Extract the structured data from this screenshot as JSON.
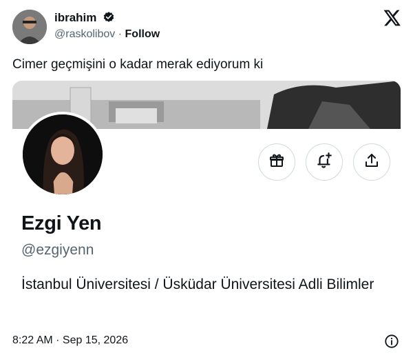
{
  "author": {
    "name": "ibrahim",
    "handle": "@raskolibov",
    "separator": "·",
    "follow_label": "Follow",
    "verified_icon": "verified-badge-icon",
    "verified_color": "#0f1419"
  },
  "platform_icon": "x-logo-icon",
  "tweet": {
    "text": "Cimer geçmişini o kadar merak ediyorum ki",
    "timestamp": "8:22 AM · Sep 15, 2026"
  },
  "profile_card": {
    "display_name": "Ezgi Yen",
    "handle": "@ezgiyenn",
    "bio": "İstanbul Üniversitesi / Üsküdar Üniversitesi Adli Bilimler",
    "actions": [
      {
        "icon": "gift-icon"
      },
      {
        "icon": "bell-plus-icon"
      },
      {
        "icon": "share-icon"
      }
    ]
  },
  "colors": {
    "text": "#0f1419",
    "secondary": "#536471",
    "border": "#cfd9de"
  }
}
